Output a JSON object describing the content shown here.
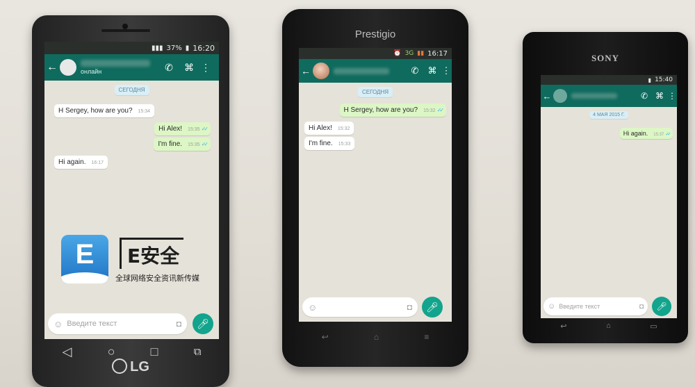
{
  "phones": {
    "lg": {
      "status_battery": "37%",
      "status_time": "16:20",
      "contact_status": "онлайн",
      "date_chip": "СЕГОДНЯ",
      "messages": [
        {
          "dir": "in",
          "text": "H Sergey, how are you?",
          "time": "15:34"
        },
        {
          "dir": "out",
          "text": "Hi Alex!",
          "time": "15:35"
        },
        {
          "dir": "out",
          "text": "I'm fine.",
          "time": "15:35"
        },
        {
          "dir": "in",
          "text": "Hi again.",
          "time": "16:17"
        }
      ],
      "input_placeholder": "Введите текст",
      "brand": "LG"
    },
    "prestigio": {
      "brand": "Prestigio",
      "status_net": "3G",
      "status_time": "16:17",
      "date_chip": "СЕГОДНЯ",
      "messages": [
        {
          "dir": "out",
          "text": "H Sergey, how are you?",
          "time": "15:32"
        },
        {
          "dir": "in",
          "text": "Hi Alex!",
          "time": "15:32"
        },
        {
          "dir": "in",
          "text": "I'm fine.",
          "time": "15:33"
        }
      ]
    },
    "sony": {
      "brand": "SONY",
      "status_time": "15:40",
      "date_chip": "4 МАЯ 2015 Г.",
      "messages": [
        {
          "dir": "out",
          "text": "Hi again.",
          "time": "15:37"
        }
      ],
      "input_placeholder": "Введите текст"
    }
  },
  "watermark": {
    "logo_letter": "E",
    "title": "E安全",
    "tagline": "全球网络安全资讯新传媒"
  }
}
